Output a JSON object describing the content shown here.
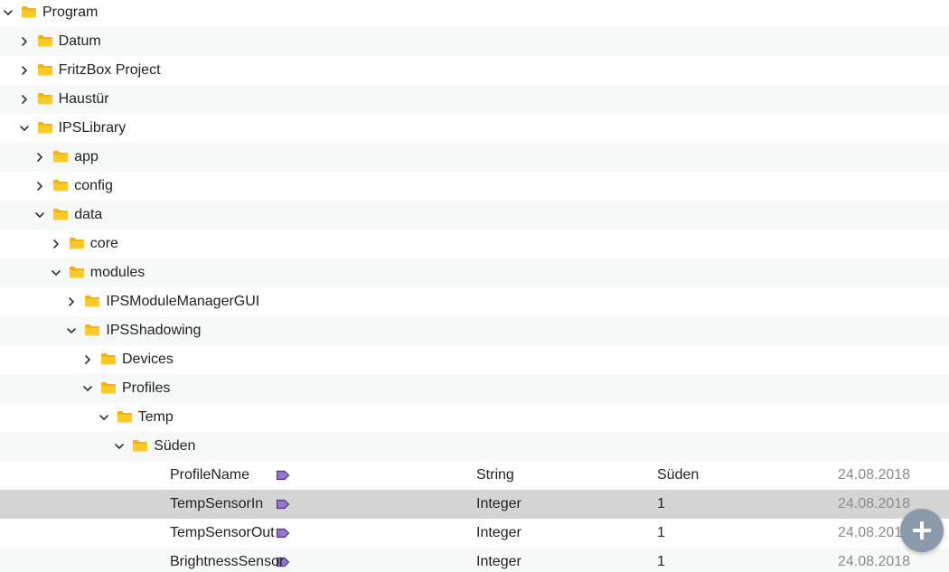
{
  "tree": {
    "rows": [
      {
        "label": "Program",
        "depth": 0,
        "kind": "folder",
        "state": "expanded"
      },
      {
        "label": "Datum",
        "depth": 1,
        "kind": "folder",
        "state": "collapsed"
      },
      {
        "label": "FritzBox Project",
        "depth": 1,
        "kind": "folder",
        "state": "collapsed"
      },
      {
        "label": "Haustür",
        "depth": 1,
        "kind": "folder",
        "state": "collapsed"
      },
      {
        "label": "IPSLibrary",
        "depth": 1,
        "kind": "folder",
        "state": "expanded"
      },
      {
        "label": "app",
        "depth": 2,
        "kind": "folder",
        "state": "collapsed"
      },
      {
        "label": "config",
        "depth": 2,
        "kind": "folder",
        "state": "collapsed"
      },
      {
        "label": "data",
        "depth": 2,
        "kind": "folder",
        "state": "expanded"
      },
      {
        "label": "core",
        "depth": 3,
        "kind": "folder",
        "state": "collapsed"
      },
      {
        "label": "modules",
        "depth": 3,
        "kind": "folder",
        "state": "expanded"
      },
      {
        "label": "IPSModuleManagerGUI",
        "depth": 4,
        "kind": "folder",
        "state": "collapsed"
      },
      {
        "label": "IPSShadowing",
        "depth": 4,
        "kind": "folder",
        "state": "expanded"
      },
      {
        "label": "Devices",
        "depth": 5,
        "kind": "folder",
        "state": "collapsed"
      },
      {
        "label": "Profiles",
        "depth": 5,
        "kind": "folder",
        "state": "expanded"
      },
      {
        "label": "Temp",
        "depth": 6,
        "kind": "folder",
        "state": "expanded"
      },
      {
        "label": "Süden",
        "depth": 7,
        "kind": "folder",
        "state": "expanded"
      },
      {
        "label": "ProfileName",
        "depth": 8,
        "kind": "variable",
        "type": "String",
        "value": "Süden",
        "date": "24.08.2018"
      },
      {
        "label": "TempSensorIn",
        "depth": 8,
        "kind": "variable",
        "type": "Integer",
        "value": "1",
        "date": "24.08.2018",
        "selected": true
      },
      {
        "label": "TempSensorOut",
        "depth": 8,
        "kind": "variable",
        "type": "Integer",
        "value": "1",
        "date": "24.08.2018"
      },
      {
        "label": "BrightnessSensor",
        "depth": 8,
        "kind": "variable",
        "type": "Integer",
        "value": "1",
        "date": "24.08.2018"
      }
    ]
  },
  "icons": {
    "folder": "folder-icon",
    "variable": "variable-tag-icon",
    "expanded": "chevron-down-icon",
    "collapsed": "chevron-right-icon",
    "add": "plus-icon"
  },
  "colors": {
    "folder_fill": "#ffca28",
    "folder_tab": "#f6b400",
    "variable_fill": "#9575cd",
    "selected_row": "#d4d4d4",
    "alt_row": "#f7f8f8",
    "fab": "#8a9aab"
  }
}
